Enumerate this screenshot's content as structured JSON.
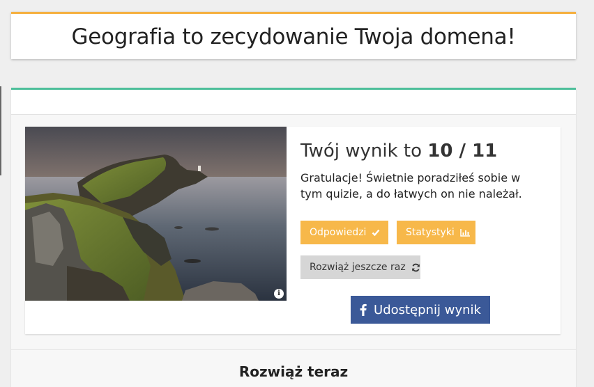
{
  "header": {
    "title": "Geografia to zecydowanie Twoja domena!"
  },
  "result": {
    "score_prefix": "Twój wynik to ",
    "score_value": "10 / 11",
    "description": "Gratulacje! Świetnie poradziłeś sobie w tym quizie, a do łatwych on nie należał.",
    "image_info_glyph": "i"
  },
  "buttons": {
    "answers_label": "Odpowiedzi",
    "stats_label": "Statystyki",
    "retry_label": "Rozwiąż jeszcze raz",
    "share_label": "Udostępnij wynik"
  },
  "footer": {
    "solve_now": "Rozwiąż teraz"
  },
  "colors": {
    "accent_top": "#f5b041",
    "accent_quiz": "#4dbf9a",
    "button_yellow": "#f7b84a",
    "button_grey": "#d6d6d6",
    "facebook": "#3b5998"
  },
  "icons": {
    "answers": "check-icon",
    "stats": "bar-chart-icon",
    "retry": "refresh-icon",
    "share": "facebook-icon",
    "image": "info-icon"
  }
}
